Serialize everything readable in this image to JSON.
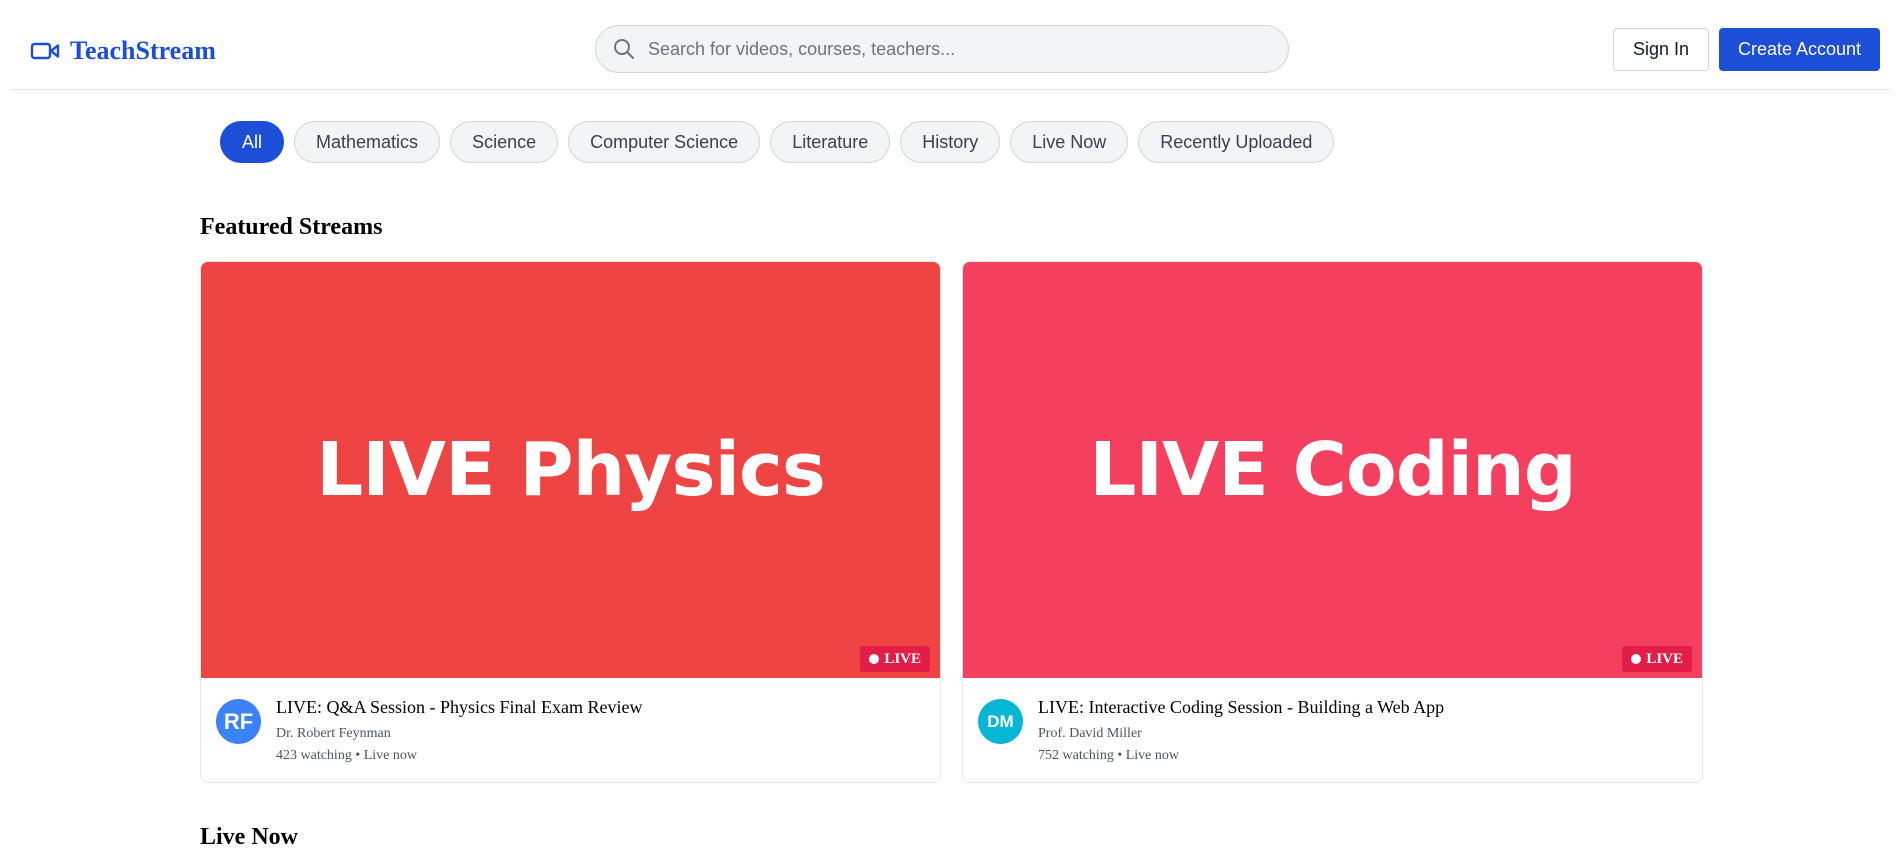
{
  "app": {
    "name": "TeachStream"
  },
  "search": {
    "placeholder": "Search for videos, courses, teachers..."
  },
  "auth": {
    "sign_in": "Sign In",
    "create_account": "Create Account"
  },
  "categories": [
    "All",
    "Mathematics",
    "Science",
    "Computer Science",
    "Literature",
    "History",
    "Live Now",
    "Recently Uploaded"
  ],
  "active_category": "All",
  "sections": {
    "featured": "Featured Streams",
    "live_now": "Live Now"
  },
  "featured": [
    {
      "thumbnail_text": "LIVE Physics",
      "thumbnail_color": "#ef4444",
      "badge": "LIVE",
      "avatar_initials": "RF",
      "avatar_color": "#3b82f6",
      "title": "LIVE: Q&A Session - Physics Final Exam Review",
      "teacher": "Dr. Robert Feynman",
      "meta": "423 watching • Live now"
    },
    {
      "thumbnail_text": "LIVE Coding",
      "thumbnail_color": "#f43f5e",
      "badge": "LIVE",
      "avatar_initials": "DM",
      "avatar_color": "#06b6d4",
      "title": "LIVE: Interactive Coding Session - Building a Web App",
      "teacher": "Prof. David Miller",
      "meta": "752 watching • Live now"
    }
  ],
  "colors": {
    "brand": "#1d4ed8",
    "live_badge": "#e11d48"
  },
  "icons": {
    "logo": "video-camera-icon",
    "search": "search-icon",
    "live": "live-dot-icon"
  }
}
